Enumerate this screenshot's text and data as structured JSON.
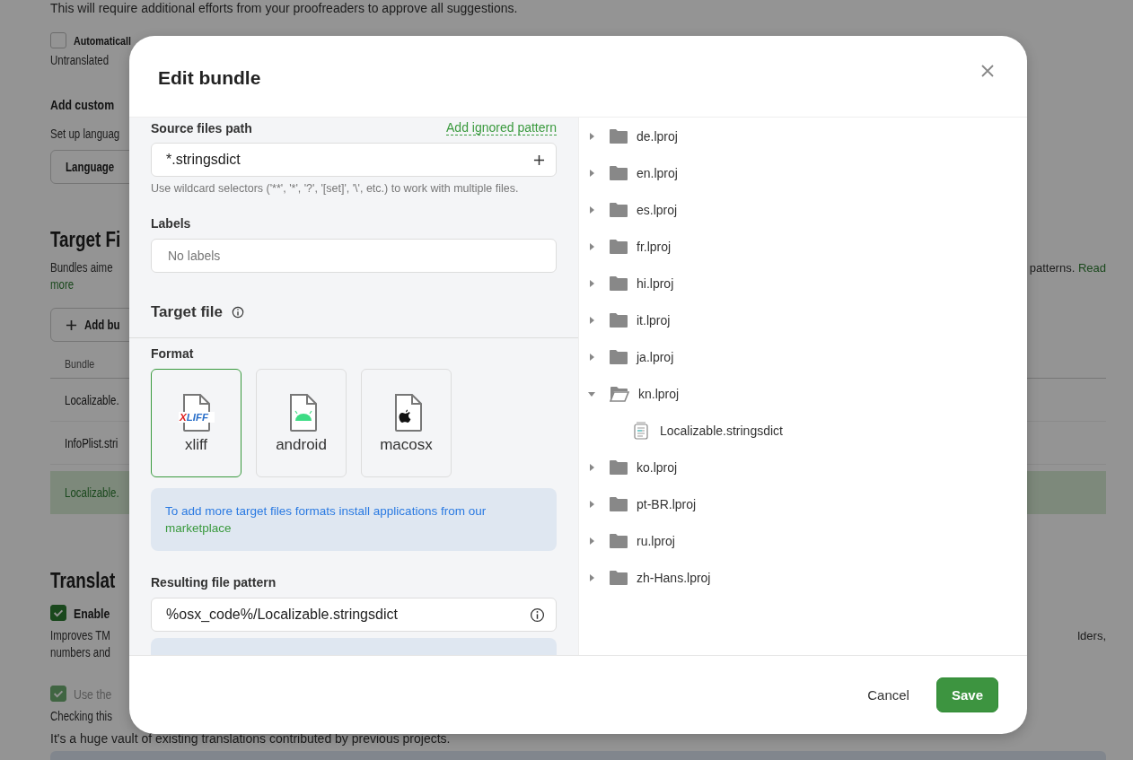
{
  "page": {
    "top_note": "This will require additional efforts from your proofreaders to approve all suggestions.",
    "autofill": {
      "label": "Automaticall",
      "checked": false
    },
    "autofill_note": "Untranslated",
    "custom_heading": "Add custom",
    "custom_note": "Set up languag",
    "language_button": "Language",
    "target_heading": "Target Fi",
    "target_note_left": "Bundles aime",
    "target_note_right": "patterns.",
    "read_more_1": "Read",
    "read_more_2": "more",
    "add_button": "Add bu",
    "table_header": "Bundle",
    "rows": [
      {
        "name": "Localizable.",
        "selected": false
      },
      {
        "name": "InfoPlist.stri",
        "selected": false
      },
      {
        "name": "Localizable.",
        "selected": true
      }
    ],
    "translation_heading": "Translat",
    "enable": {
      "label": "Enable",
      "checked": true,
      "disabled": false
    },
    "enable_note_left": "Improves TM",
    "enable_note_right": "lders,",
    "enable_note_2": "numbers and",
    "global": {
      "label": "Use the",
      "checked": true,
      "disabled": true
    },
    "global_note_1": "Checking this",
    "global_note_2": "It's a huge vault of existing translations contributed by previous projects."
  },
  "dialog": {
    "title": "Edit bundle",
    "source_label": "Source files path",
    "ignore_link": "Add ignored pattern",
    "source_value": "*.stringsdict",
    "source_hint": "Use wildcard selectors ('**', '*', '?', '[set]', '\\', etc.) to work with multiple files.",
    "labels_label": "Labels",
    "labels_placeholder": "No labels",
    "target_title": "Target file",
    "format_label": "Format",
    "formats": [
      {
        "label": "xliff",
        "kind": "xliff",
        "badge": "XLIFF",
        "selected": true
      },
      {
        "label": "android",
        "kind": "android",
        "selected": false
      },
      {
        "label": "macosx",
        "kind": "macosx",
        "selected": false
      }
    ],
    "info_text": "To add more target files formats install applications from our",
    "info_link": "marketplace",
    "pattern_label": "Resulting file pattern",
    "pattern_value": "%osx_code%/Localizable.stringsdict",
    "tree": [
      {
        "name": "de.lproj",
        "expanded": false
      },
      {
        "name": "en.lproj",
        "expanded": false
      },
      {
        "name": "es.lproj",
        "expanded": false
      },
      {
        "name": "fr.lproj",
        "expanded": false
      },
      {
        "name": "hi.lproj",
        "expanded": false
      },
      {
        "name": "it.lproj",
        "expanded": false
      },
      {
        "name": "ja.lproj",
        "expanded": false
      },
      {
        "name": "kn.lproj",
        "expanded": true,
        "children": [
          {
            "name": "Localizable.stringsdict"
          }
        ]
      },
      {
        "name": "ko.lproj",
        "expanded": false
      },
      {
        "name": "pt-BR.lproj",
        "expanded": false
      },
      {
        "name": "ru.lproj",
        "expanded": false
      },
      {
        "name": "zh-Hans.lproj",
        "expanded": false
      }
    ],
    "buttons": {
      "cancel": "Cancel",
      "save": "Save"
    }
  }
}
